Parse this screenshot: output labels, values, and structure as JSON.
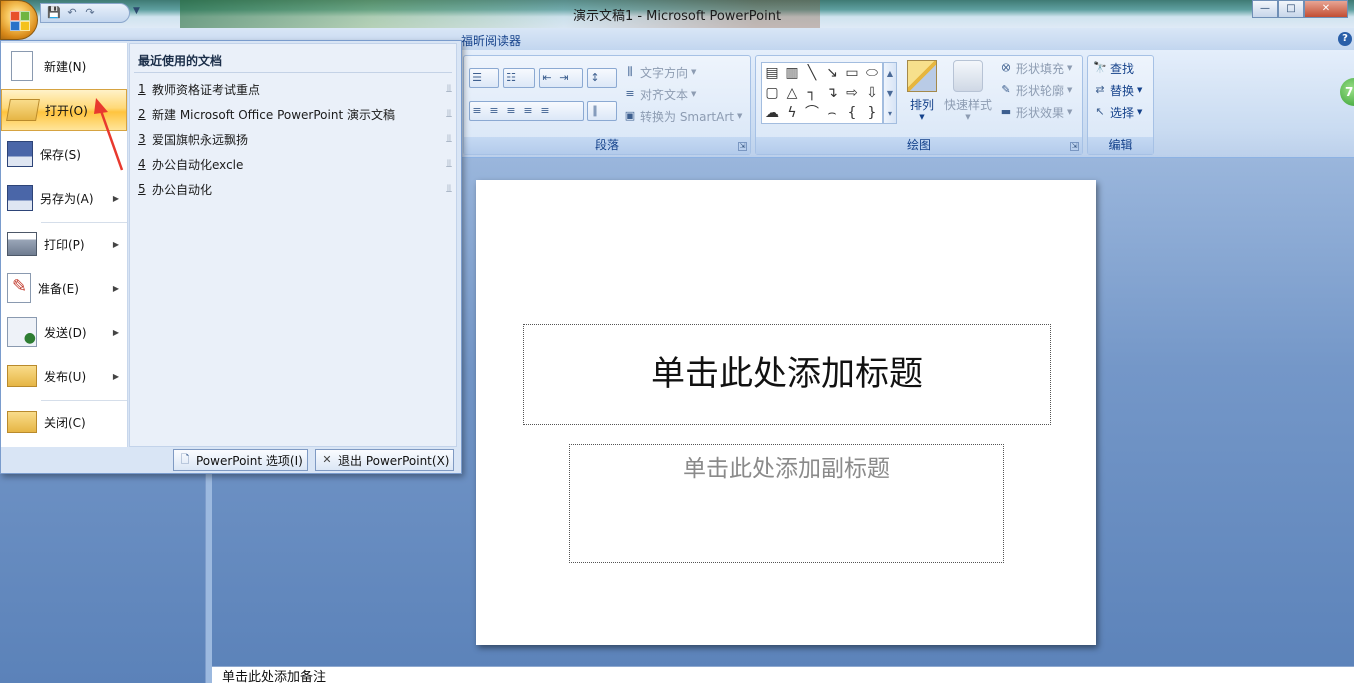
{
  "window": {
    "title": "演示文稿1 - Microsoft PowerPoint"
  },
  "qat": {
    "save_icon": "save-icon",
    "undo_icon": "undo-icon",
    "redo_icon": "redo-icon",
    "customize_icon": "chevron-down-icon"
  },
  "ribbon": {
    "visible_tab": "福昕阅读器",
    "paragraph": {
      "label": "段落",
      "text_direction": "文字方向",
      "align_text": "对齐文本",
      "convert_smartart": "转换为 SmartArt"
    },
    "drawing": {
      "label": "绘图",
      "arrange": "排列",
      "quick_styles": "快速样式",
      "shape_fill": "形状填充",
      "shape_outline": "形状轮廓",
      "shape_effects": "形状效果"
    },
    "editing": {
      "label": "编辑",
      "find": "查找",
      "replace": "替换",
      "select": "选择"
    }
  },
  "office_menu": {
    "items": [
      {
        "label": "新建(N)",
        "icon": "new-document-icon"
      },
      {
        "label": "打开(O)",
        "icon": "open-folder-icon"
      },
      {
        "label": "保存(S)",
        "icon": "save-icon"
      },
      {
        "label": "另存为(A)",
        "icon": "save-as-icon"
      },
      {
        "label": "打印(P)",
        "icon": "printer-icon"
      },
      {
        "label": "准备(E)",
        "icon": "prepare-icon"
      },
      {
        "label": "发送(D)",
        "icon": "send-icon"
      },
      {
        "label": "发布(U)",
        "icon": "publish-icon"
      },
      {
        "label": "关闭(C)",
        "icon": "close-folder-icon"
      }
    ],
    "recent_header": "最近使用的文档",
    "recent": [
      {
        "num": "1",
        "name": "教师资格证考试重点"
      },
      {
        "num": "2",
        "name": "新建 Microsoft Office PowerPoint 演示文稿"
      },
      {
        "num": "3",
        "name": "爱国旗帜永远飘扬"
      },
      {
        "num": "4",
        "name": "办公自动化excle"
      },
      {
        "num": "5",
        "name": "办公自动化"
      }
    ],
    "options_button": "PowerPoint 选项(I)",
    "exit_button": "退出 PowerPoint(X)"
  },
  "slide": {
    "title_placeholder": "单击此处添加标题",
    "subtitle_placeholder": "单击此处添加副标题"
  },
  "notes": {
    "placeholder": "单击此处添加备注"
  },
  "colors": {
    "ribbon_text": "#15428b",
    "active_menu_item": "#ffd978",
    "annotation_arrow": "#e8392e"
  }
}
